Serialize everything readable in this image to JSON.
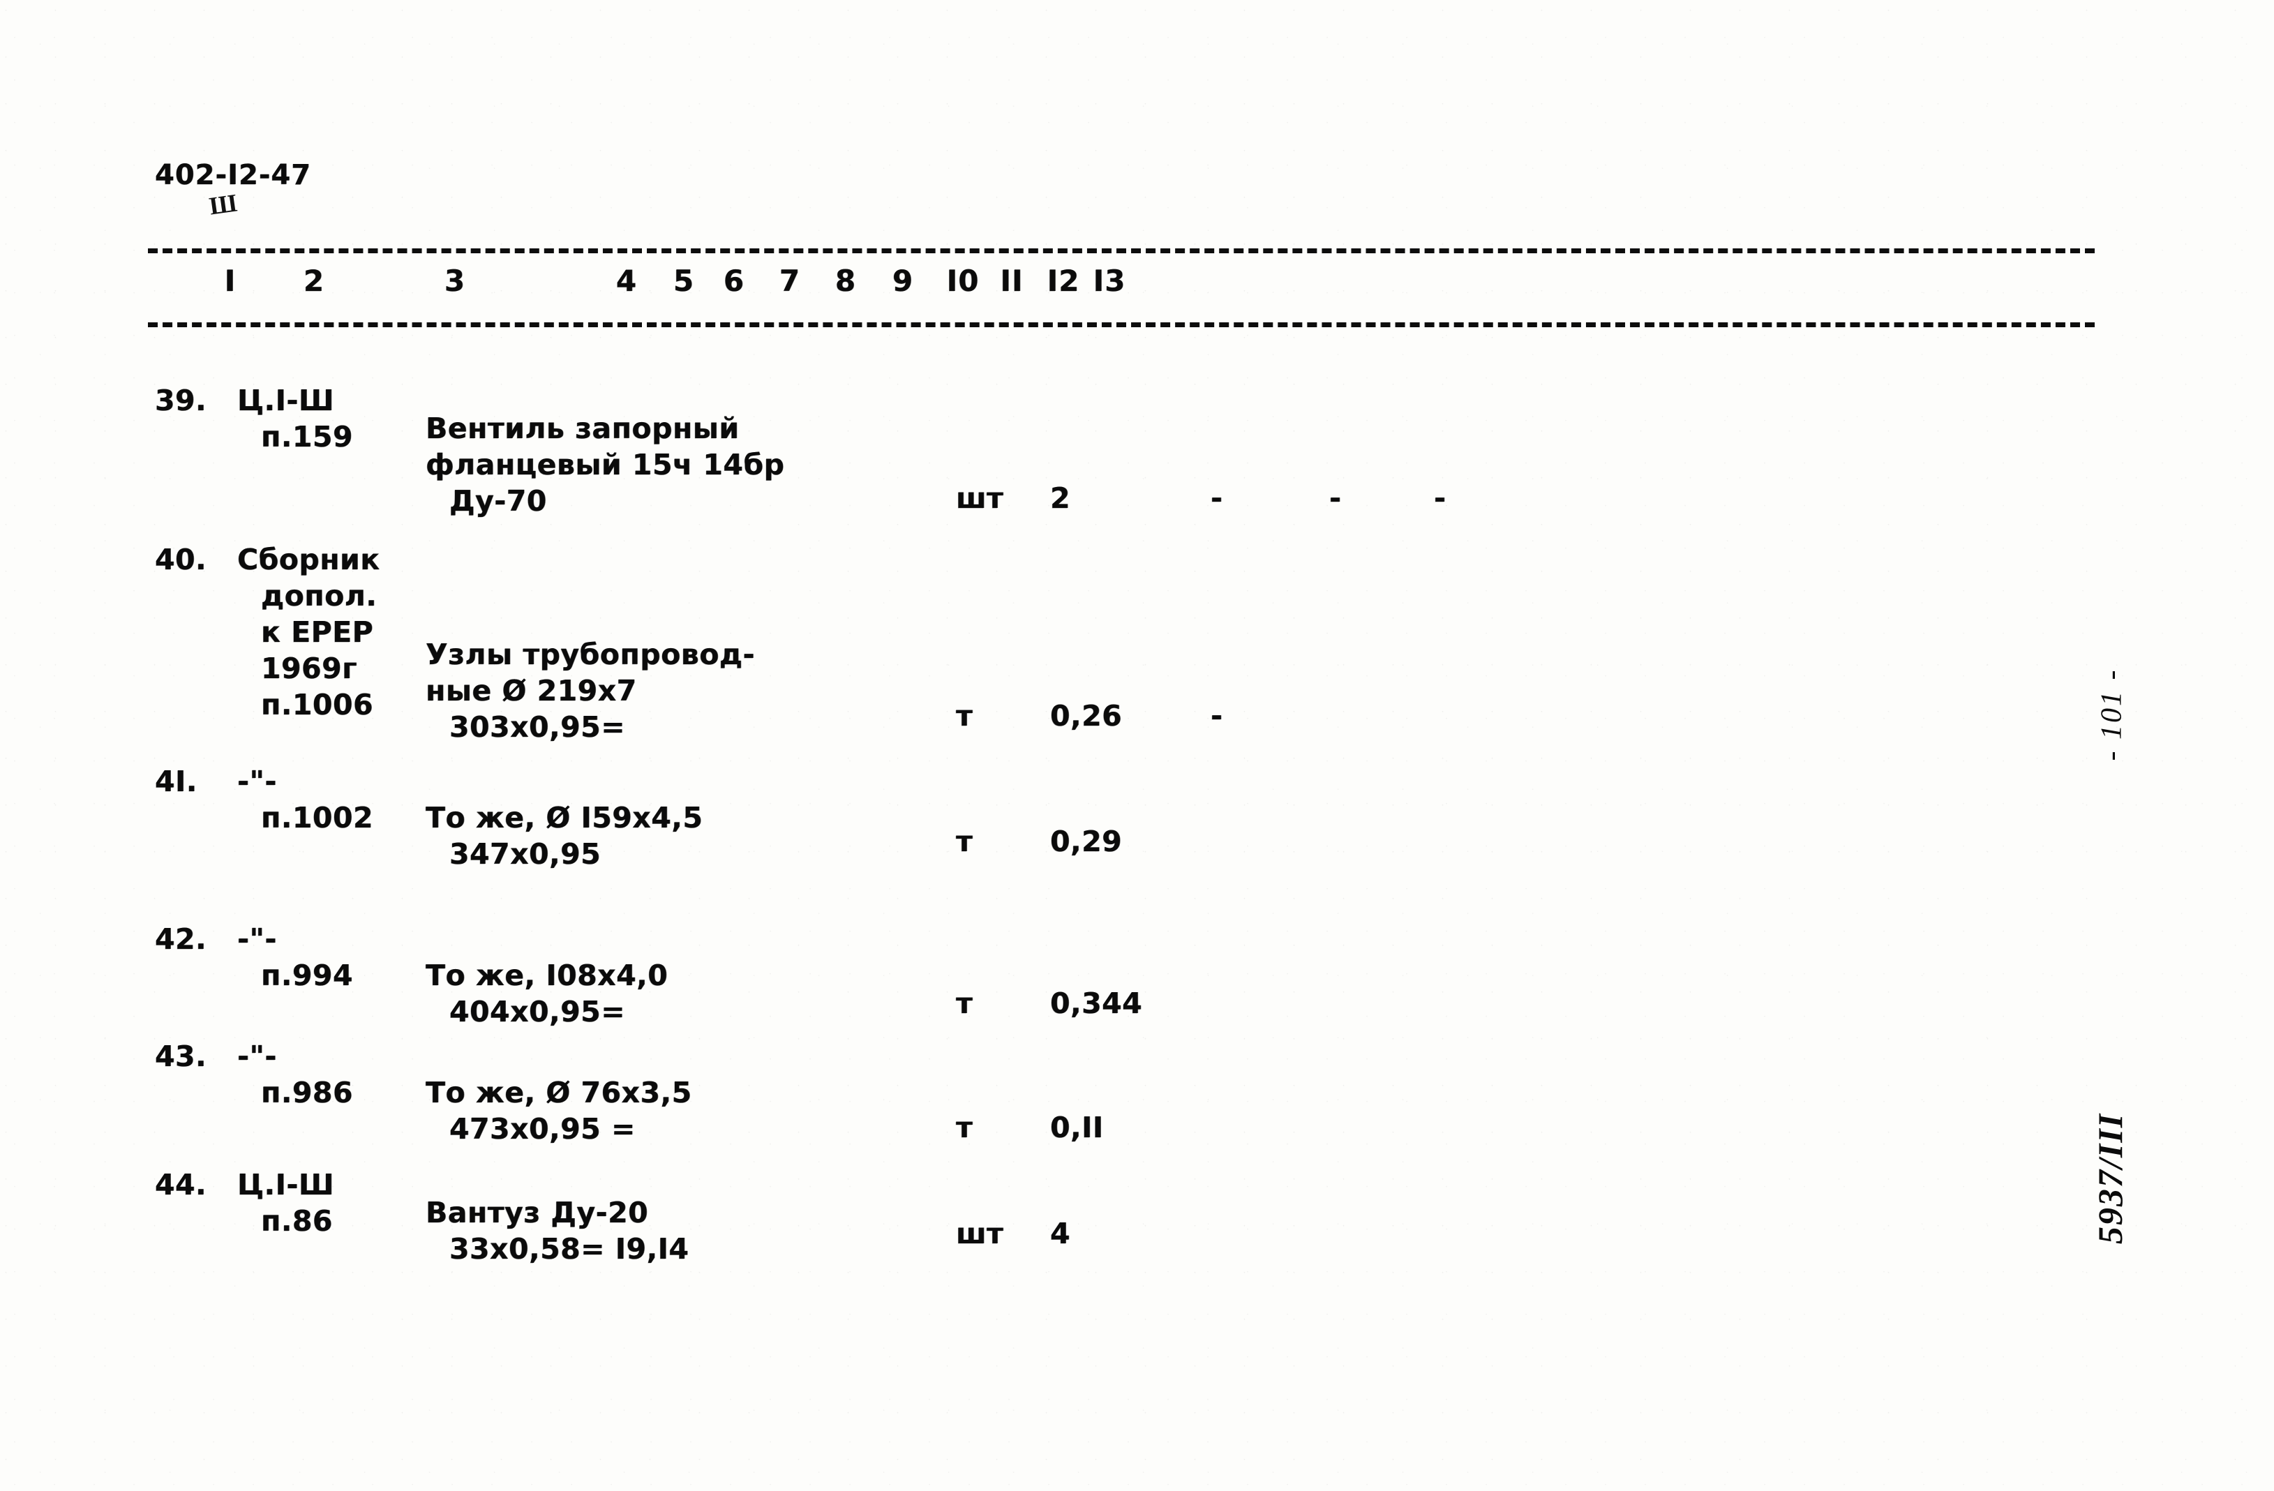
{
  "document": {
    "code": "402-I2-47",
    "code_mark": "Ш"
  },
  "table": {
    "column_numbers": [
      "I",
      "2",
      "3",
      "4",
      "5",
      "6",
      "7",
      "8",
      "9",
      "I0",
      "II",
      "I2",
      "I3"
    ],
    "rows": [
      {
        "num": "39.",
        "code_lines": [
          "Ц.I-Ш",
          "п.159"
        ],
        "desc_lines": [
          "Вентиль запорный",
          "фланцевый 15ч 14бр",
          "Ду-70"
        ],
        "unit": "шт",
        "qty": "2",
        "col6": "-",
        "col7": "-",
        "col9": "-"
      },
      {
        "num": "40.",
        "code_lines": [
          "Сборник",
          "допол.",
          "к ЕРЕР",
          "1969г",
          "п.1006"
        ],
        "desc_lines": [
          "Узлы трубопровод-",
          "ные Ø 219х7",
          "303х0,95="
        ],
        "unit": "т",
        "qty": "0,26",
        "col6": "-",
        "col7": "",
        "col9": ""
      },
      {
        "num": "4I.",
        "code_lines": [
          "-\"-",
          "п.1002"
        ],
        "desc_lines": [
          "То же, Ø I59х4,5",
          "347х0,95"
        ],
        "unit": "т",
        "qty": "0,29",
        "col6": "",
        "col7": "",
        "col9": ""
      },
      {
        "num": "42.",
        "code_lines": [
          "-\"-",
          "п.994"
        ],
        "desc_lines": [
          "То же, I08х4,0",
          "404х0,95="
        ],
        "unit": "т",
        "qty": "0,344",
        "col6": "",
        "col7": "",
        "col9": ""
      },
      {
        "num": "43.",
        "code_lines": [
          "-\"-",
          "п.986"
        ],
        "desc_lines": [
          "То же, Ø 76х3,5",
          "473х0,95 ="
        ],
        "unit": "т",
        "qty": "0,II",
        "col6": "",
        "col7": "",
        "col9": ""
      },
      {
        "num": "44.",
        "code_lines": [
          "Ц.I-Ш",
          "п.86"
        ],
        "desc_lines": [
          "Вантуз Ду-20",
          "33х0,58= I9,I4"
        ],
        "unit": "шт",
        "qty": "4",
        "col6": "",
        "col7": "",
        "col9": ""
      }
    ]
  },
  "margin_notes": {
    "page_number": "- 101 -",
    "archive": "5937/III"
  }
}
